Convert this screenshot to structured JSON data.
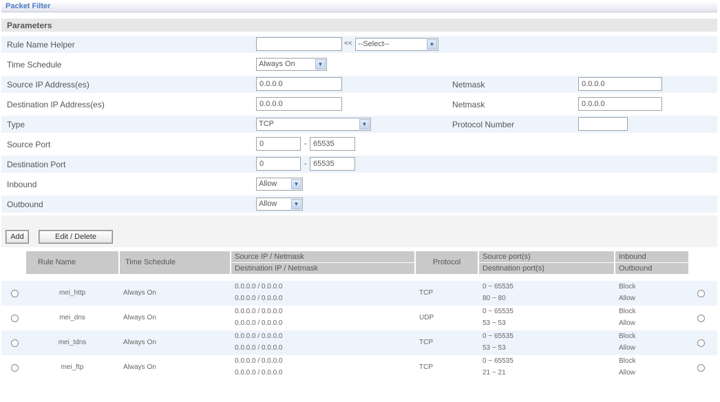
{
  "title": "Packet Filter",
  "parameters_heading": "Parameters",
  "form": {
    "rule_name_helper": {
      "label": "Rule Name  Helper",
      "value": "",
      "arrows": "<<",
      "select": "--Select--"
    },
    "time_schedule": {
      "label": "Time Schedule",
      "select": "Always On"
    },
    "source_ip": {
      "label": "Source IP Address(es)",
      "value": "0.0.0.0",
      "netmask_label": "Netmask",
      "netmask": "0.0.0.0"
    },
    "destination_ip": {
      "label": "Destination IP Address(es)",
      "value": "0.0.0.0",
      "netmask_label": "Netmask",
      "netmask": "0.0.0.0"
    },
    "type": {
      "label": "Type",
      "select": "TCP",
      "protocol_number_label": "Protocol Number",
      "protocol_number": ""
    },
    "source_port": {
      "label": "Source Port",
      "from": "0",
      "dash": "-",
      "to": "65535"
    },
    "destination_port": {
      "label": "Destination Port",
      "from": "0",
      "dash": "-",
      "to": "65535"
    },
    "inbound": {
      "label": "Inbound",
      "select": "Allow"
    },
    "outbound": {
      "label": "Outbound",
      "select": "Allow"
    }
  },
  "buttons": {
    "add": "Add",
    "edit_delete": "Edit / Delete"
  },
  "table": {
    "headers": {
      "rule_name": "Rule Name",
      "time_schedule": "Time Schedule",
      "source_ip_netmask": "Source IP / Netmask",
      "destination_ip_netmask": "Destination IP / Netmask",
      "protocol": "Protocol",
      "source_ports": "Source port(s)",
      "destination_ports": "Destination port(s)",
      "inbound": "Inbound",
      "outbound": "Outbound"
    },
    "rows": [
      {
        "name": "mei_http",
        "schedule": "Always On",
        "src": "0.0.0.0 / 0.0.0.0",
        "dst": "0.0.0.0 / 0.0.0.0",
        "protocol": "TCP",
        "src_port": "0 ~ 65535",
        "dst_port": "80 ~ 80",
        "inbound": "Block",
        "outbound": "Allow"
      },
      {
        "name": "mei_dns",
        "schedule": "Always On",
        "src": "0.0.0.0 / 0.0.0.0",
        "dst": "0.0.0.0 / 0.0.0.0",
        "protocol": "UDP",
        "src_port": "0 ~ 65535",
        "dst_port": "53 ~ 53",
        "inbound": "Block",
        "outbound": "Allow"
      },
      {
        "name": "mei_tdns",
        "schedule": "Always On",
        "src": "0.0.0.0 / 0.0.0.0",
        "dst": "0.0.0.0 / 0.0.0.0",
        "protocol": "TCP",
        "src_port": "0 ~ 65535",
        "dst_port": "53 ~ 53",
        "inbound": "Block",
        "outbound": "Allow"
      },
      {
        "name": "mei_ftp",
        "schedule": "Always On",
        "src": "0.0.0.0 / 0.0.0.0",
        "dst": "0.0.0.0 / 0.0.0.0",
        "protocol": "TCP",
        "src_port": "0 ~ 65535",
        "dst_port": "21 ~ 21",
        "inbound": "Block",
        "outbound": "Allow"
      }
    ]
  },
  "colors": {
    "title": "#4a7bc4",
    "alt_row": "#eef4fb",
    "header_gray": "#c9c9c9"
  }
}
